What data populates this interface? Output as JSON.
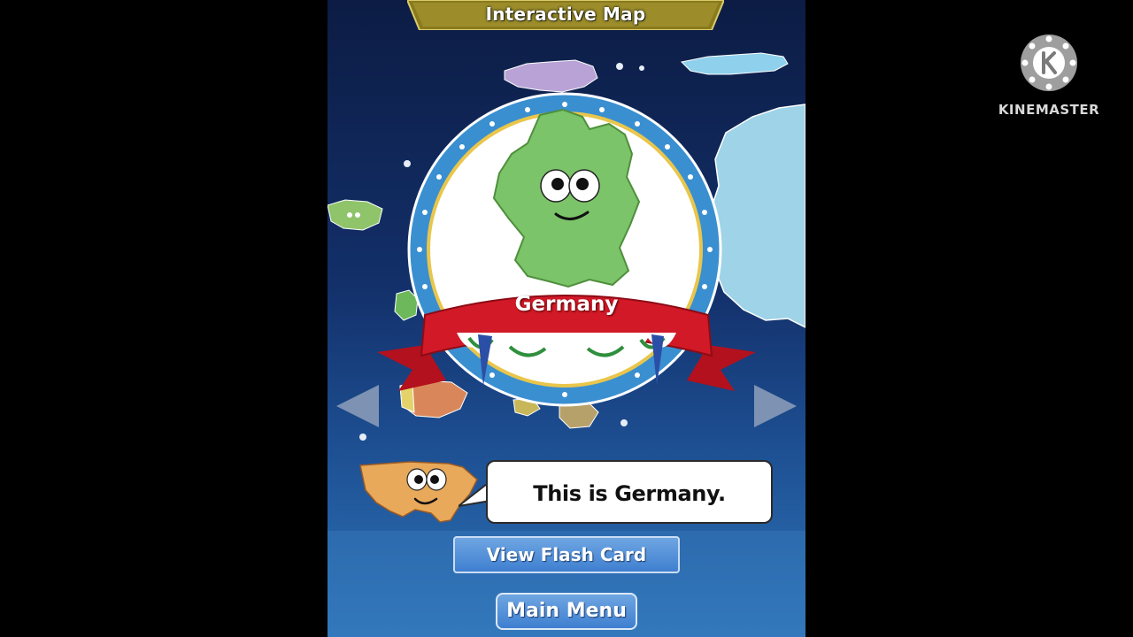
{
  "header": {
    "title": "Interactive Map"
  },
  "country": {
    "name": "Germany"
  },
  "dialog": {
    "text": "This is Germany."
  },
  "buttons": {
    "flash_card": "View Flash Card",
    "main_menu": "Main Menu"
  },
  "nav": {
    "prev_icon": "arrow-left-icon",
    "next_icon": "arrow-right-icon"
  },
  "watermark": {
    "brand": "KINEMASTER"
  },
  "colors": {
    "background": "#0c1c44",
    "button": "#3f7fd0",
    "banner": "#c8102e",
    "germany": "#7cc46a"
  }
}
